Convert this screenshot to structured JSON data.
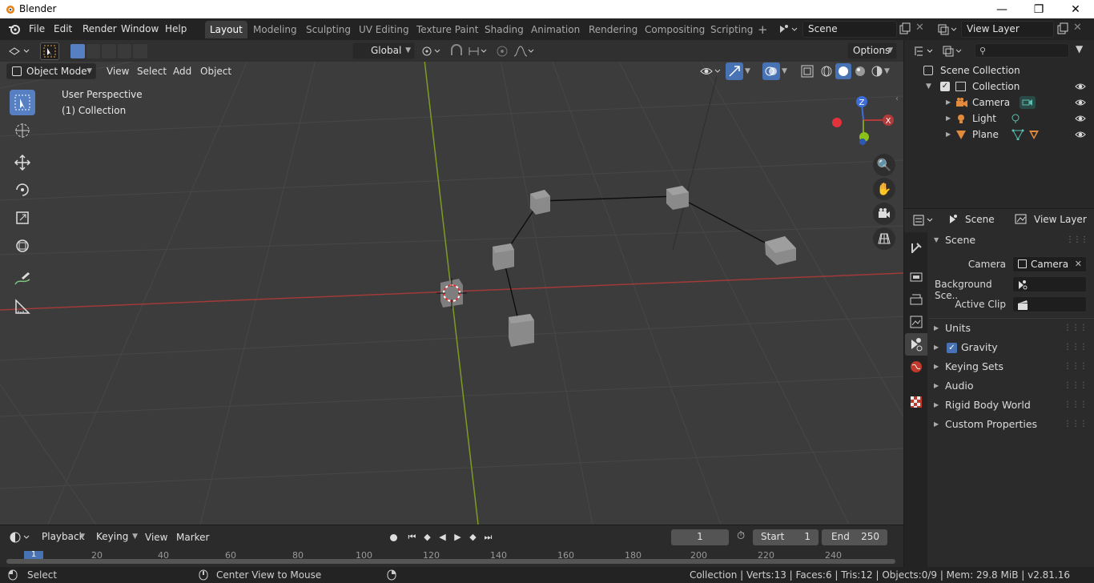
{
  "window": {
    "title": "Blender"
  },
  "menubar": {
    "items": [
      "File",
      "Edit",
      "Render",
      "Window",
      "Help"
    ],
    "workspaces": [
      "Layout",
      "Modeling",
      "Sculpting",
      "UV Editing",
      "Texture Paint",
      "Shading",
      "Animation",
      "Rendering",
      "Compositing",
      "Scripting"
    ],
    "active_workspace": "Layout",
    "add_tab": "+",
    "scene": "Scene",
    "view_layer": "View Layer"
  },
  "viewport_header": {
    "transform_orientation": "Global",
    "options": "Options",
    "mode": "Object Mode",
    "menus": [
      "View",
      "Select",
      "Add",
      "Object"
    ]
  },
  "viewport": {
    "perspective_label": "User Perspective",
    "collection_label": "(1) Collection",
    "axis_labels": {
      "z": "Z",
      "x": "X"
    }
  },
  "outliner": {
    "root": "Scene Collection",
    "collection": "Collection",
    "objects": [
      {
        "name": "Camera",
        "icon": "camera-icon",
        "color": "#e38b3c"
      },
      {
        "name": "Light",
        "icon": "light-icon",
        "color": "#e38b3c"
      },
      {
        "name": "Plane",
        "icon": "mesh-icon",
        "color": "#e38b3c"
      }
    ]
  },
  "properties": {
    "tab_scene": "Scene",
    "tab_view_layer": "View Layer",
    "panel_title": "Scene",
    "camera_label": "Camera",
    "camera_value": "Camera",
    "background_label": "Background Sce..",
    "active_clip_label": "Active Clip",
    "subpanels": [
      "Units",
      "Gravity",
      "Keying Sets",
      "Audio",
      "Rigid Body World",
      "Custom Properties"
    ],
    "gravity_checked": true
  },
  "timeline": {
    "menus": [
      "Playback",
      "Keying",
      "View",
      "Marker"
    ],
    "current_frame": "1",
    "start_label": "Start",
    "start_value": "1",
    "end_label": "End",
    "end_value": "250",
    "ruler": [
      "1",
      "20",
      "40",
      "60",
      "80",
      "100",
      "120",
      "140",
      "160",
      "180",
      "200",
      "220",
      "240"
    ]
  },
  "statusbar": {
    "left_action": "Select",
    "middle_action": "Center View to Mouse",
    "stats": "Collection | Verts:13 | Faces:6 | Tris:12 | Objects:0/9 | Mem: 29.8 MiB | v2.81.16"
  },
  "colors": {
    "accent": "#5680c2",
    "x_axis": "#b33a3a",
    "y_axis": "#7fa12a",
    "z_axis": "#3c6dd8"
  }
}
